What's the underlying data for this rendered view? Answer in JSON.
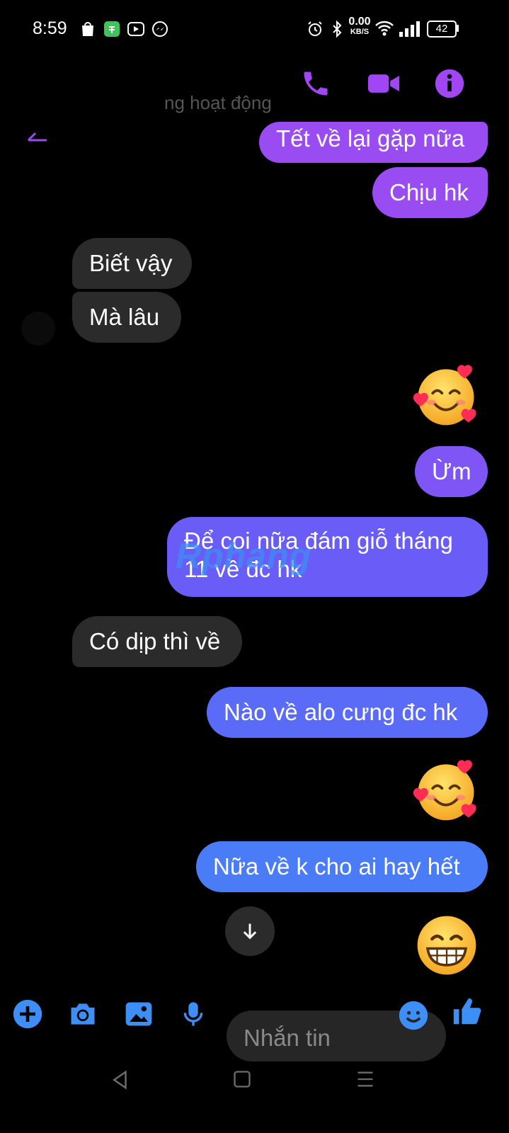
{
  "status_bar": {
    "time": "8:59",
    "net_speed_value": "0.00",
    "net_speed_unit": "KB/S",
    "battery": "42"
  },
  "header": {
    "subtitle": "ng hoạt động"
  },
  "messages": [
    {
      "side": "sent",
      "text": "Tết về lại gặp nữa"
    },
    {
      "side": "sent",
      "text": "Chịu hk"
    },
    {
      "side": "received",
      "text": "Biết vậy"
    },
    {
      "side": "received",
      "text": "Mà lâu"
    },
    {
      "side": "sent",
      "type": "emoji",
      "emoji": "smiling-face-with-hearts"
    },
    {
      "side": "sent",
      "text": "Ừm"
    },
    {
      "side": "sent",
      "text_line1": "Để coi nữa đám giỗ tháng",
      "text_line2": "11 về đc hk"
    },
    {
      "side": "received",
      "text": "Có dịp thì về"
    },
    {
      "side": "sent",
      "text": "Nào về alo cưng đc hk"
    },
    {
      "side": "sent",
      "type": "emoji",
      "emoji": "smiling-face-with-hearts"
    },
    {
      "side": "sent",
      "text": "Nữa về k cho ai hay hết"
    },
    {
      "side": "sent",
      "type": "emoji",
      "emoji": "grinning-face"
    }
  ],
  "watermark": "Rphang",
  "composer": {
    "placeholder": "Nhắn tin"
  },
  "colors": {
    "accent": "#a146f5",
    "bubble_purple": "#9a4cf3",
    "bubble_indigo": "#6a5df7",
    "bubble_blue": "#4a7cf7",
    "received_bubble": "#2b2b2b",
    "toolbar_blue": "#3d8ef5"
  },
  "icons": [
    "phone-icon",
    "video-icon",
    "info-icon",
    "plus-icon",
    "camera-icon",
    "image-icon",
    "mic-icon",
    "emoji-icon",
    "like-icon",
    "scroll-down-icon"
  ]
}
